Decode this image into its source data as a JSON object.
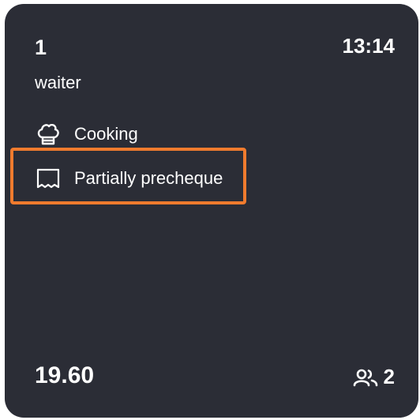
{
  "order": {
    "table_number": "1",
    "time": "13:14",
    "waiter": "waiter",
    "statuses": [
      {
        "icon": "chef-hat-icon",
        "label": "Cooking"
      },
      {
        "icon": "receipt-icon",
        "label": "Partially precheque"
      }
    ],
    "total": "19.60",
    "guests_icon": "users-icon",
    "guests_count": "2"
  },
  "colors": {
    "card_background": "#2b2d36",
    "highlight": "#f07b2e",
    "text": "#ffffff"
  }
}
